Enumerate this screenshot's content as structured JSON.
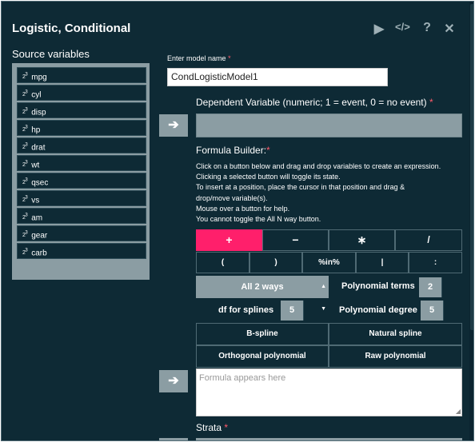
{
  "window": {
    "title": "Logistic, Conditional",
    "toolbar": [
      {
        "name": "run-icon",
        "glyph": "▶"
      },
      {
        "name": "code-icon",
        "glyph": "</>"
      },
      {
        "name": "help-icon",
        "glyph": "?"
      },
      {
        "name": "close-icon",
        "glyph": "✕"
      }
    ]
  },
  "source": {
    "label": "Source variables",
    "icon_glyph": "2 3",
    "variables": [
      "mpg",
      "cyl",
      "disp",
      "hp",
      "drat",
      "wt",
      "qsec",
      "vs",
      "am",
      "gear",
      "carb"
    ]
  },
  "model_name": {
    "label": "Enter model name",
    "required": "*",
    "value": "CondLogisticModel1"
  },
  "dependent": {
    "label": "Dependent Variable (numeric; 1 = event, 0 = no event)",
    "required": "*",
    "move_glyph": "➔"
  },
  "formula_builder": {
    "label": "Formula Builder:",
    "required": "*",
    "help_lines": [
      "Click on a button below and drag and drop variables to create an expression.",
      "Clicking a selected button will toggle its state.",
      "To insert at a position, place the cursor in that position and drag &",
      "drop/move variable(s).",
      "Mouse over a button for help.",
      "You cannot toggle the All N way button."
    ],
    "operators_row1": [
      "+",
      "−",
      "∗",
      "/"
    ],
    "operators_row2": [
      "(",
      ")",
      "%in%",
      "|",
      ":"
    ],
    "all_ways": "All 2 ways",
    "polynomial_terms_label": "Polynomial terms",
    "polynomial_terms_value": "2",
    "df_splines_label": "df for splines",
    "df_splines_value": "5",
    "polynomial_degree_label": "Polynomial degree",
    "polynomial_degree_value": "5",
    "special": [
      "B-spline",
      "Natural spline",
      "Orthogonal polynomial",
      "Raw polynomial"
    ],
    "formula_placeholder": "Formula appears here",
    "move_glyph": "➔"
  },
  "strata": {
    "label": "Strata",
    "required": "*"
  },
  "colors": {
    "background": "#0e2a35",
    "accent": "#ff1f6b",
    "panel": "#8b9da3"
  }
}
